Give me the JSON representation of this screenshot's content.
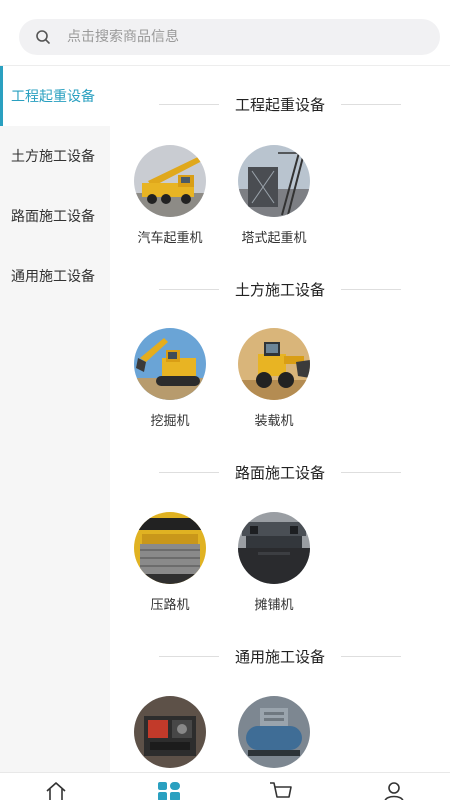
{
  "search": {
    "placeholder": "点击搜索商品信息"
  },
  "sidebar": {
    "items": [
      {
        "label": "工程起重设备"
      },
      {
        "label": "土方施工设备"
      },
      {
        "label": "路面施工设备"
      },
      {
        "label": "通用施工设备"
      }
    ]
  },
  "sections": [
    {
      "title": "工程起重设备",
      "products": [
        {
          "name": "汽车起重机"
        },
        {
          "name": "塔式起重机"
        }
      ]
    },
    {
      "title": "土方施工设备",
      "products": [
        {
          "name": "挖掘机"
        },
        {
          "name": "装载机"
        }
      ]
    },
    {
      "title": "路面施工设备",
      "products": [
        {
          "name": "压路机"
        },
        {
          "name": "摊铺机"
        }
      ]
    },
    {
      "title": "通用施工设备",
      "products": [
        {
          "name": ""
        },
        {
          "name": ""
        }
      ]
    }
  ],
  "colors": {
    "accent": "#2aa0c0",
    "sidebar_bg": "#f6f6f6",
    "page_bg": "#ffffff"
  },
  "tabbar": {
    "tabs": [
      {
        "icon": "home-icon"
      },
      {
        "icon": "category-icon"
      },
      {
        "icon": "cart-icon"
      },
      {
        "icon": "user-icon"
      }
    ]
  }
}
